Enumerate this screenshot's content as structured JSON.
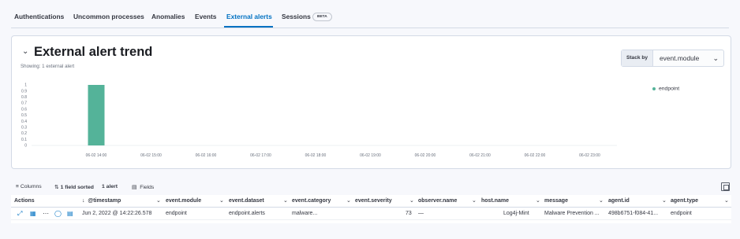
{
  "tabs": {
    "items": [
      {
        "label": "Authentications"
      },
      {
        "label": "Uncommon processes"
      },
      {
        "label": "Anomalies"
      },
      {
        "label": "Events"
      },
      {
        "label": "External alerts"
      },
      {
        "label": "Sessions"
      }
    ],
    "active": "External alerts",
    "beta_badge": "BETA"
  },
  "panel": {
    "title": "External alert trend",
    "subtitle": "Showing: 1 external alert",
    "stack_by": {
      "label": "Stack by",
      "value": "event.module"
    },
    "legend": [
      {
        "label": "endpoint",
        "color": "#54b399"
      }
    ]
  },
  "chart_data": {
    "type": "bar",
    "x": [
      "06-02 14:00",
      "06-02 15:00",
      "06-02 16:00",
      "06-02 17:00",
      "06-02 18:00",
      "06-02 19:00",
      "06-02 20:00",
      "06-02 21:00",
      "06-02 22:00",
      "06-02 23:00"
    ],
    "series": [
      {
        "name": "endpoint",
        "color": "#54b399",
        "values": [
          1,
          0,
          0,
          0,
          0,
          0,
          0,
          0,
          0,
          0
        ]
      }
    ],
    "y_ticks": [
      "1",
      "0.9",
      "0.8",
      "0.7",
      "0.6",
      "0.5",
      "0.4",
      "0.3",
      "0.2",
      "0.1",
      "0"
    ],
    "ylim": [
      0,
      1
    ],
    "legend_position": "top-right"
  },
  "toolbar": {
    "columns": "Columns",
    "sorted": "1 field sorted",
    "count": "1 alert",
    "fields": "Fields"
  },
  "grid": {
    "headers": [
      "Actions",
      "@timestamp",
      "event.module",
      "event.dataset",
      "event.category",
      "event.severity",
      "observer.name",
      "host.name",
      "message",
      "agent.id",
      "agent.type"
    ],
    "row": {
      "timestamp": "Jun 2, 2022 @ 14:22:26.578",
      "event_module": "endpoint",
      "event_dataset": "endpoint.alerts",
      "event_category": "malware...",
      "event_severity": "73",
      "observer_name": "—",
      "host_name": "Log4j-Mint",
      "message": "Malware Prevention ...",
      "agent_id": "498b6751-f084-41...",
      "agent_type": "endpoint"
    }
  }
}
